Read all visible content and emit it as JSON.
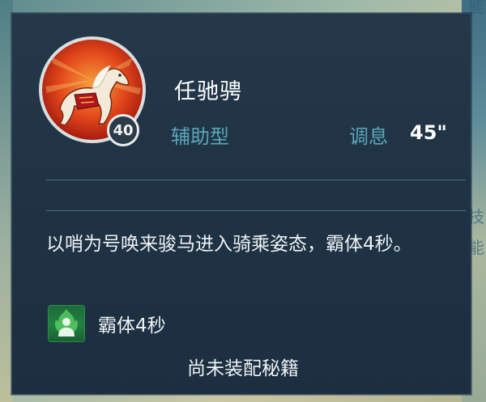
{
  "skill": {
    "name": "任驰骋",
    "type": "辅助型",
    "level": "40",
    "cooldown_label": "调息",
    "cooldown_value": "45\""
  },
  "description": "以哨为号唤来骏马进入骑乘姿态，霸体4秒。",
  "effect": {
    "icon": "green-figure-icon",
    "label": "霸体4秒"
  },
  "footer": {
    "status": "尚未装配秘籍"
  },
  "background": {
    "right_edge_text_1": "能",
    "right_edge_text_2": "技",
    "right_edge_text_3": "能"
  },
  "colors": {
    "panel": "#1f3345",
    "accent_teal": "#5aa7b8",
    "effect_green": "#21813f"
  }
}
